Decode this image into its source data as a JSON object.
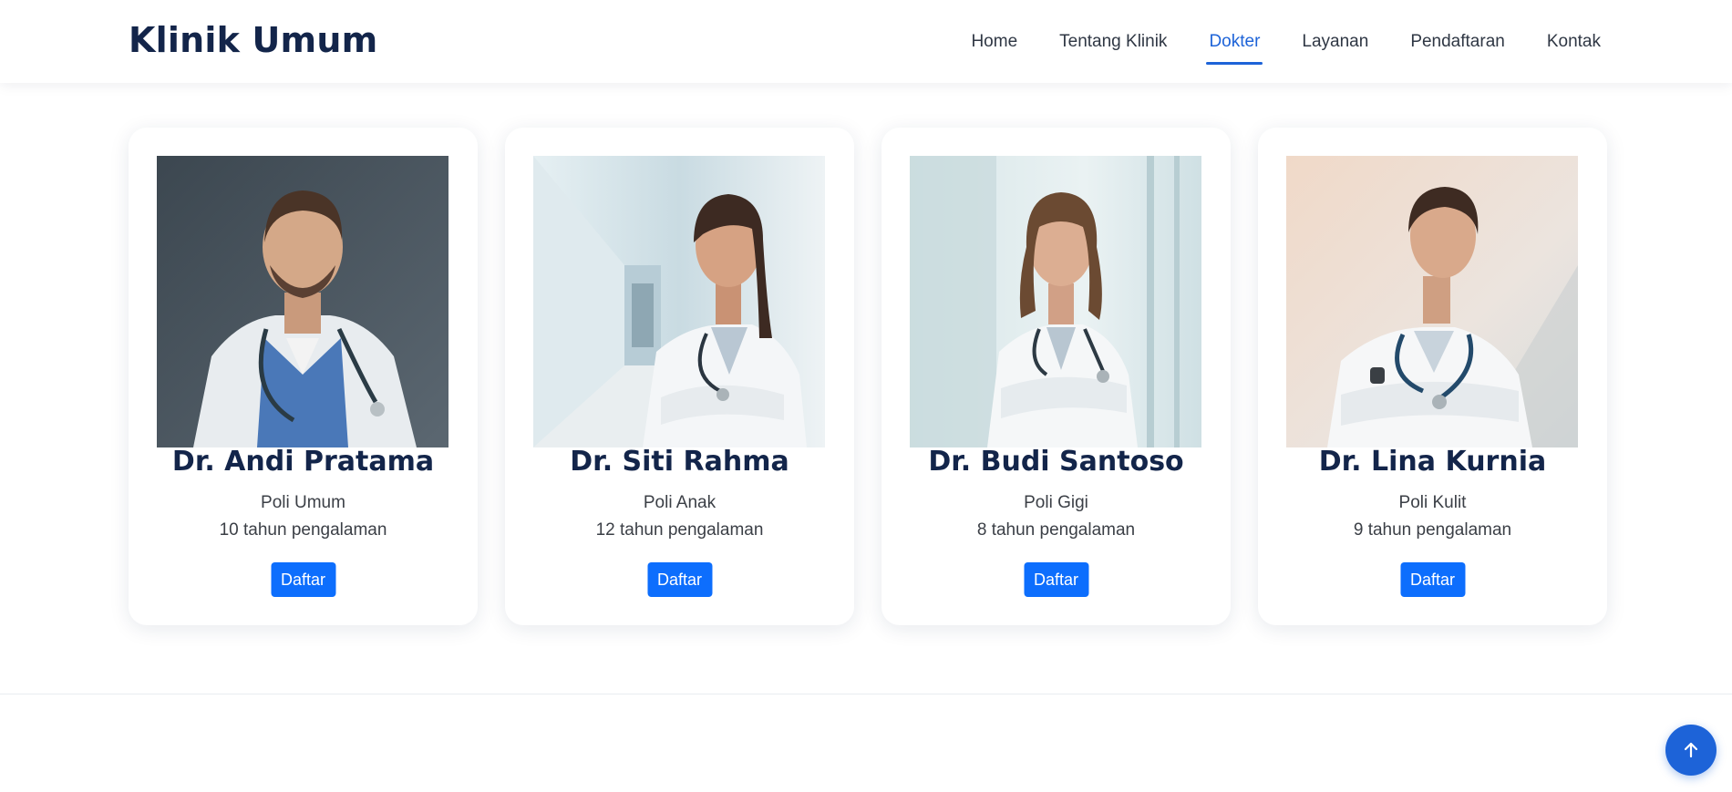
{
  "header": {
    "logo": "Klinik Umum",
    "nav": [
      {
        "label": "Home",
        "active": false
      },
      {
        "label": "Tentang Klinik",
        "active": false
      },
      {
        "label": "Dokter",
        "active": true
      },
      {
        "label": "Layanan",
        "active": false
      },
      {
        "label": "Pendaftaran",
        "active": false
      },
      {
        "label": "Kontak",
        "active": false
      }
    ],
    "accent_color": "#1d63d8"
  },
  "doctors": [
    {
      "name": "Dr. Andi Pratama",
      "poli": "Poli Umum",
      "experience": "10 tahun pengalaman",
      "button": "Daftar",
      "photo": "doctor-photo-male-scrubs"
    },
    {
      "name": "Dr. Siti Rahma",
      "poli": "Poli Anak",
      "experience": "12 tahun pengalaman",
      "button": "Daftar",
      "photo": "doctor-photo-female-hallway"
    },
    {
      "name": "Dr. Budi Santoso",
      "poli": "Poli Gigi",
      "experience": "8 tahun pengalaman",
      "button": "Daftar",
      "photo": "doctor-photo-female-glass"
    },
    {
      "name": "Dr. Lina Kurnia",
      "poli": "Poli Kulit",
      "experience": "9 tahun pengalaman",
      "button": "Daftar",
      "photo": "doctor-photo-male-coat"
    }
  ],
  "button_color": "#0d6efd",
  "back_to_top": {
    "icon": "arrow-up-icon"
  }
}
